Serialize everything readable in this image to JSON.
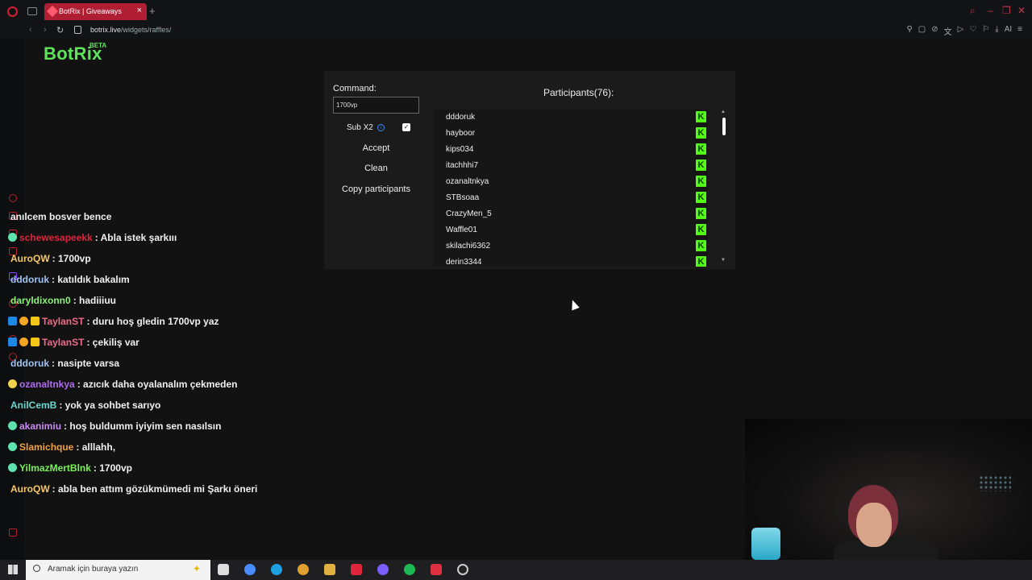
{
  "browser": {
    "tab_title": "BotRix | Giveaways",
    "tab_close": "×",
    "new_tab": "+",
    "url_host": "botrix.live",
    "url_path": "/widgets/raffles/",
    "toolbar_ai": "AI"
  },
  "page": {
    "logo": "BotRix",
    "logo_badge": "BETA"
  },
  "widget": {
    "command_label": "Command:",
    "command_value": "1700vp",
    "sub_label": "Sub X2",
    "sub_info": "i",
    "sub_checked": "✓",
    "accept_button": "Accept",
    "clean_button": "Clean",
    "copy_button": "Copy participants",
    "participants_title": "Participants(76):",
    "kick_glyph": "K",
    "participants": [
      "dddoruk",
      "hayboor",
      "kips034",
      "itachhhi7",
      "ozanaltnkya",
      "STBsoaa",
      "CrazyMen_5",
      "Waffle01",
      "skilachi6362",
      "derin3344"
    ]
  },
  "chat": {
    "messages": [
      {
        "user": "",
        "text": "anılcem bosver bence",
        "color": "#f0f0f0",
        "badges": []
      },
      {
        "user": "schewesapeekk",
        "text": ": Abla istek şarkııı",
        "color": "#e0243a",
        "badges": [
          "k"
        ]
      },
      {
        "user": "AuroQW",
        "text": ": 1700vp",
        "color": "#f4c86a",
        "badges": []
      },
      {
        "user": "dddoruk",
        "text": ": katıldık bakalım",
        "color": "#9ec2f0",
        "badges": []
      },
      {
        "user": "daryldixonn0",
        "text": ": hadiiiuu",
        "color": "#8df07a",
        "badges": []
      },
      {
        "user": "TaylanST",
        "text": ": duru hoş gledin 1700vp yaz",
        "color": "#f06a8a",
        "badges": [
          "mod",
          "one",
          "crown"
        ]
      },
      {
        "user": "TaylanST",
        "text": ": çekiliş var",
        "color": "#f06a8a",
        "badges": [
          "mod",
          "one",
          "crown"
        ]
      },
      {
        "user": "dddoruk",
        "text": ": nasipte varsa",
        "color": "#9ec2f0",
        "badges": []
      },
      {
        "user": "ozanaltnkya",
        "text": ": azıcık daha oyalanalım çekmeden",
        "color": "#b06af0",
        "badges": [
          "gold"
        ]
      },
      {
        "user": "AnilCemB",
        "text": ": yok ya sohbet sarıyo",
        "color": "#6ad6d0",
        "badges": []
      },
      {
        "user": "akanimiu",
        "text": ": hoş buldumm iyiyim sen nasılsın",
        "color": "#c78cf0",
        "badges": [
          "k"
        ]
      },
      {
        "user": "Slamichque",
        "text": ": alllahh,",
        "color": "#f0a040",
        "badges": [
          "k"
        ]
      },
      {
        "user": "YilmazMertBlnk",
        "text": ": 1700vp",
        "color": "#7cf05a",
        "badges": [
          "k"
        ]
      },
      {
        "user": "AuroQW",
        "text": ": abla ben attım gözükmümedi mi Şarkı öneri",
        "color": "#f4c86a",
        "badges": []
      }
    ]
  },
  "taskbar": {
    "search_placeholder": "Aramak için buraya yazın",
    "icon_colors": [
      "#ddd",
      "#4a8cff",
      "#1fa0e0",
      "#e0a030",
      "#e0b040",
      "#e0243a",
      "#7a5cff",
      "#1db954",
      "#e03040",
      "#cccccc"
    ]
  }
}
